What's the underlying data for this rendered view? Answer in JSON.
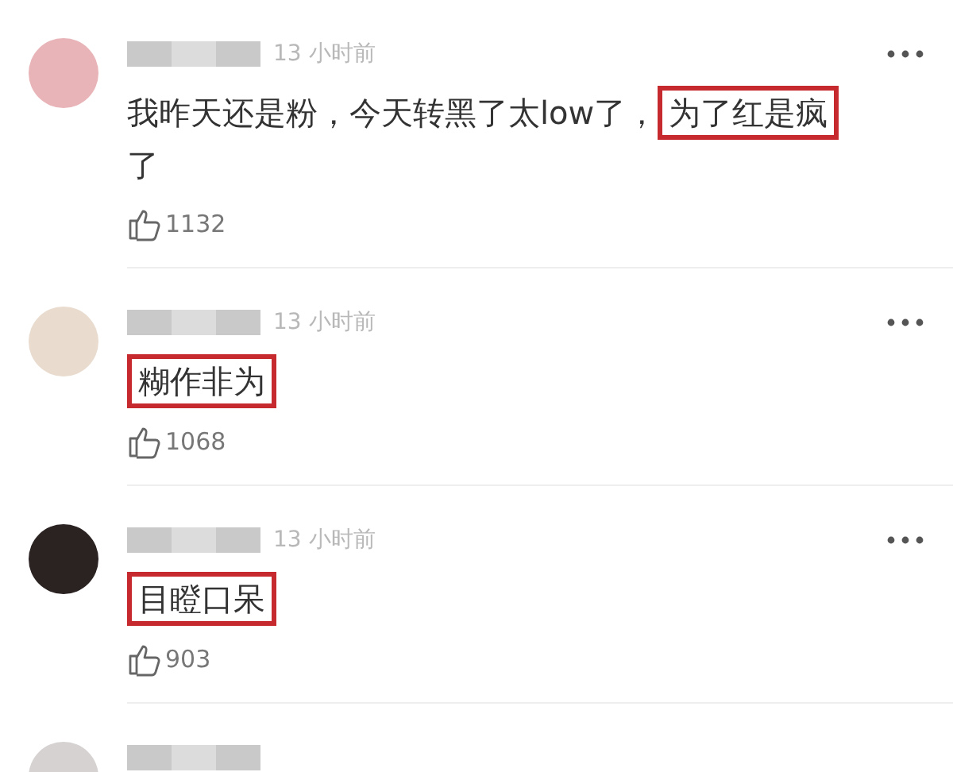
{
  "comments": [
    {
      "time": "13 小时前",
      "segments": [
        {
          "text": "我昨天还是粉，今天转黑了太low了，",
          "highlighted": false
        },
        {
          "text": "为了红是疯",
          "highlighted": true
        },
        {
          "text": "了",
          "highlighted": false
        }
      ],
      "likes": "1132",
      "color": "#e8b4b8"
    },
    {
      "time": "13 小时前",
      "segments": [
        {
          "text": "糊作非为",
          "highlighted": true
        }
      ],
      "likes": "1068",
      "color": "#e9dccf"
    },
    {
      "time": "13 小时前",
      "segments": [
        {
          "text": "目瞪口呆",
          "highlighted": true
        }
      ],
      "likes": "903",
      "color": "#2b2222"
    },
    {
      "color": "#d6d2d2"
    }
  ]
}
